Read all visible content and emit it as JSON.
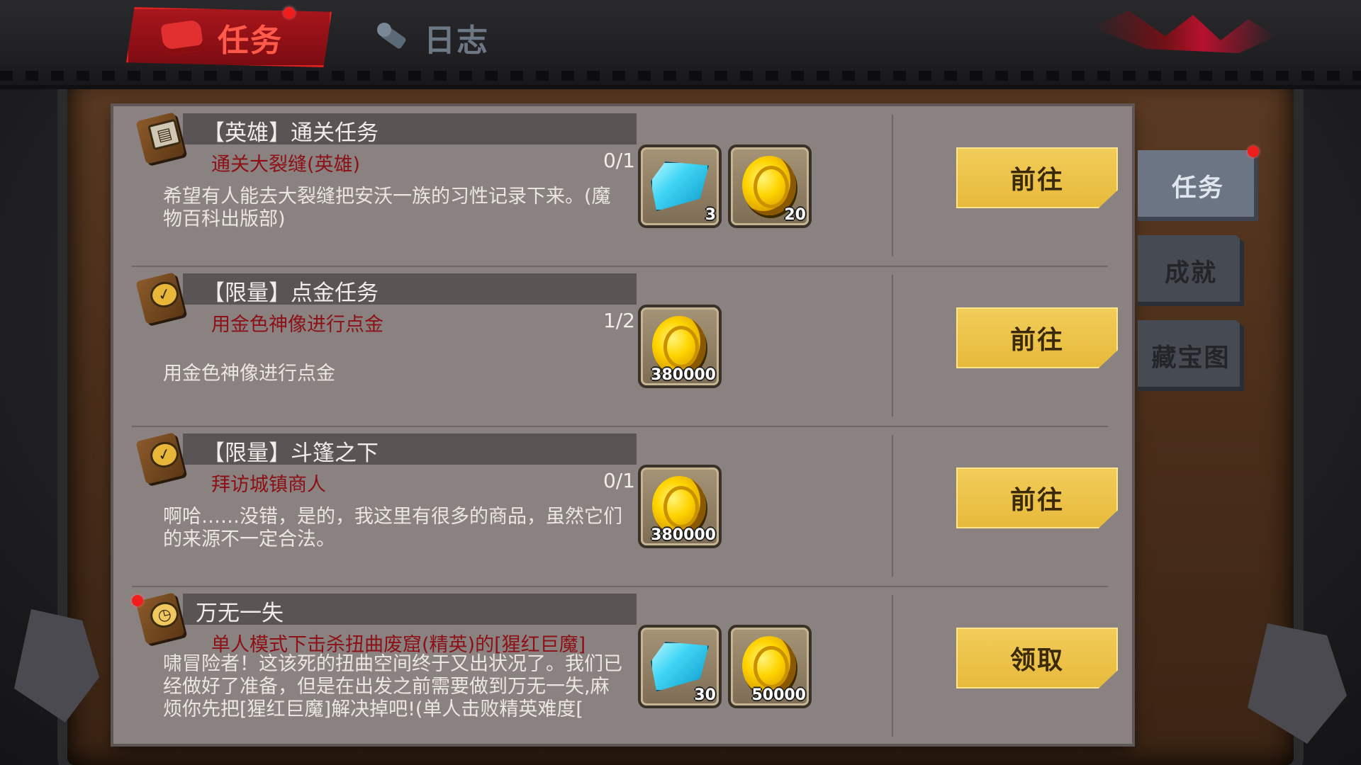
{
  "tabs": {
    "quests": "任务",
    "journal": "日志"
  },
  "side_tabs": {
    "quests": "任务",
    "achievements": "成就",
    "treasure_map": "藏宝图"
  },
  "quests": [
    {
      "title": "【英雄】通关任务",
      "objective": "通关大裂缝(英雄)",
      "progress": "0/1",
      "description": "希望有人能去大裂缝把安沃一族的习性记录下来。(魔物百科出版部)",
      "rewards": [
        {
          "type": "diamond",
          "count": "3"
        },
        {
          "type": "gold",
          "count": "20"
        }
      ],
      "button": "前往",
      "icon": "book-hero-icon"
    },
    {
      "title": "【限量】点金任务",
      "objective": "用金色神像进行点金",
      "progress": "1/2",
      "description": "用金色神像进行点金",
      "rewards": [
        {
          "type": "gold",
          "count": "380000"
        }
      ],
      "button": "前往",
      "icon": "book-check-icon"
    },
    {
      "title": "【限量】斗篷之下",
      "objective": "拜访城镇商人",
      "progress": "0/1",
      "description": "啊哈……没错，是的，我这里有很多的商品，虽然它们的来源不一定合法。",
      "rewards": [
        {
          "type": "gold",
          "count": "380000"
        }
      ],
      "button": "前往",
      "icon": "book-check-icon"
    },
    {
      "title": "万无一失",
      "objective": "单人模式下击杀扭曲废窟(精英)的[猩红巨魔]",
      "progress": "",
      "description": "啸冒险者！这该死的扭曲空间终于又出状况了。我们已经做好了准备，但是在出发之前需要做到万无一失,麻烦你先把[猩红巨魔]解决掉吧!(单人击败精英难度[",
      "rewards": [
        {
          "type": "diamond",
          "count": "30"
        },
        {
          "type": "gold",
          "count": "50000"
        }
      ],
      "button": "领取",
      "icon": "book-clock-icon"
    }
  ],
  "colors": {
    "panel": "#8a8280",
    "objective_text": "#8c1016",
    "button_gold": "#e6b93a",
    "active_tab_red": "#a8161c",
    "notification_dot": "#f01d1d"
  }
}
